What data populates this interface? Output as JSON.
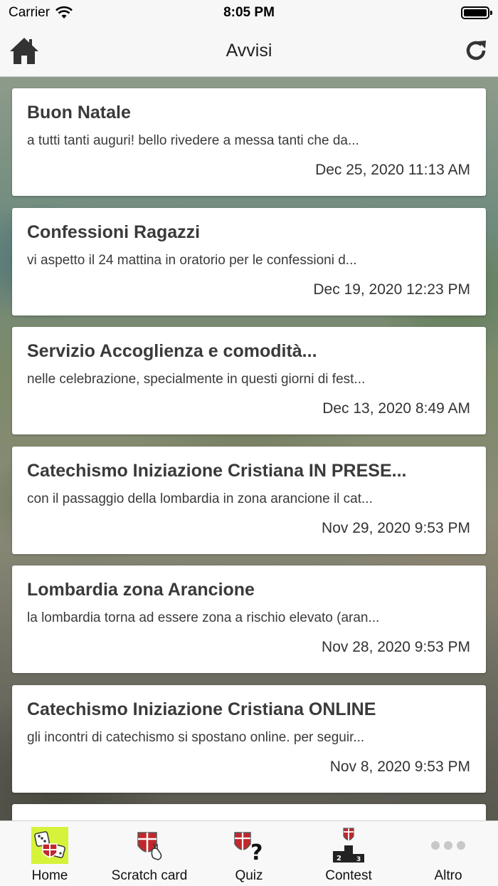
{
  "status_bar": {
    "carrier": "Carrier",
    "time": "8:05 PM"
  },
  "nav": {
    "title": "Avvisi"
  },
  "notices": [
    {
      "title": "Buon Natale",
      "snippet": "a tutti tanti auguri! bello rivedere a messa tanti che da...",
      "date": "Dec 25, 2020 11:13 AM"
    },
    {
      "title": "Confessioni Ragazzi",
      "snippet": "vi aspetto il 24 mattina in oratorio per le confessioni d...",
      "date": "Dec 19, 2020 12:23 PM"
    },
    {
      "title": "Servizio Accoglienza e comodità...",
      "snippet": "nelle celebrazione, specialmente in questi giorni di fest...",
      "date": "Dec 13, 2020 8:49 AM"
    },
    {
      "title": "Catechismo Iniziazione Cristiana IN PRESE...",
      "snippet": "con il passaggio della lombardia in zona arancione il cat...",
      "date": "Nov 29, 2020 9:53 PM"
    },
    {
      "title": "Lombardia zona Arancione",
      "snippet": "la lombardia torna ad essere zona a rischio elevato (aran...",
      "date": "Nov 28, 2020 9:53 PM"
    },
    {
      "title": "Catechismo Iniziazione Cristiana ONLINE",
      "snippet": "gli incontri di catechismo si spostano online. per seguir...",
      "date": "Nov 8, 2020 9:53 PM"
    }
  ],
  "tabs": [
    {
      "label": "Home",
      "icon": "home-dice-icon",
      "selected": true
    },
    {
      "label": "Scratch card",
      "icon": "scratch-card-icon",
      "selected": false
    },
    {
      "label": "Quiz",
      "icon": "quiz-icon",
      "selected": false
    },
    {
      "label": "Contest",
      "icon": "podium-icon",
      "selected": false
    },
    {
      "label": "Altro",
      "icon": "more-dots-icon",
      "selected": false
    }
  ],
  "colors": {
    "tab_selected_bg": "#d6f23a",
    "shield_red": "#c0282d"
  }
}
